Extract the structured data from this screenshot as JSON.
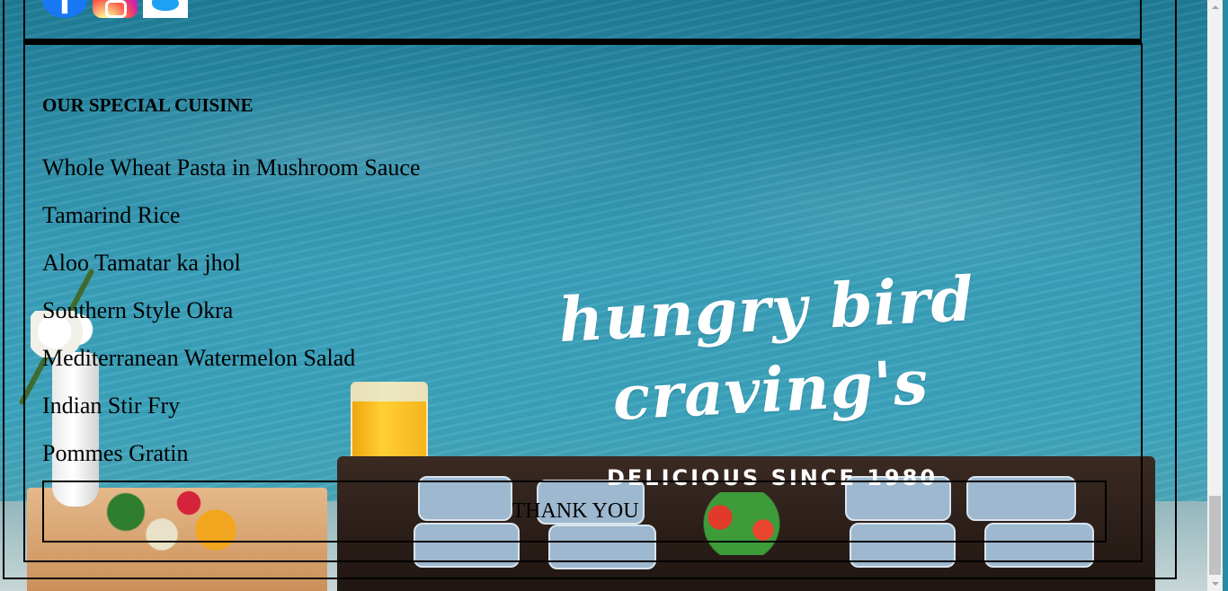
{
  "brand": {
    "name": "hungry bird craving's",
    "tagline": "DELICIOUS SINCE 1980"
  },
  "social": {
    "items": [
      {
        "name": "facebook",
        "icon": "facebook-icon",
        "color": "#1877f2"
      },
      {
        "name": "instagram",
        "icon": "instagram-icon",
        "color": "#d6249f"
      },
      {
        "name": "twitter",
        "icon": "twitter-icon",
        "color": "#1da1f2"
      }
    ]
  },
  "cuisine": {
    "heading": "OUR SPECIAL CUISINE",
    "items": [
      "Whole Wheat Pasta in Mushroom Sauce",
      "Tamarind Rice",
      "Aloo Tamatar ka jhol",
      "Southern Style Okra",
      "Mediterranean Watermelon Salad",
      "Indian Stir Fry",
      "Pommes Gratin"
    ]
  },
  "footer": {
    "thank_you": "THANK YOU"
  }
}
